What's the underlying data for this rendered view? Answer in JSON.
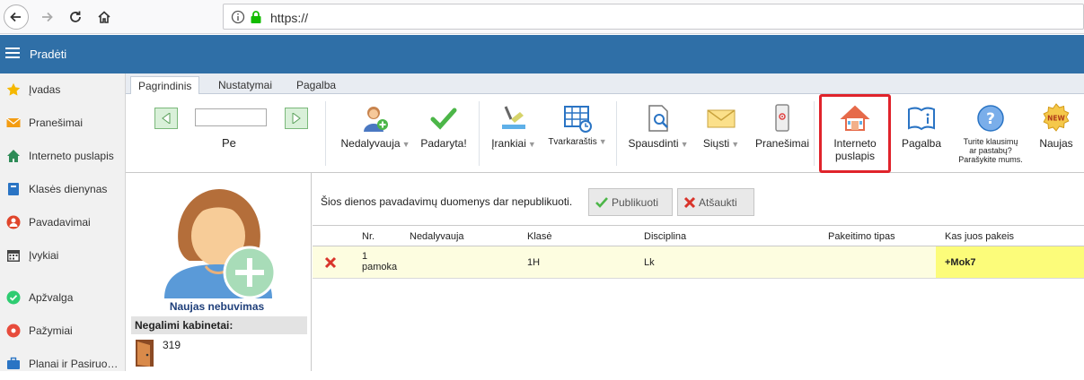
{
  "browser": {
    "url": "https://"
  },
  "header": {
    "title": "Pradėti"
  },
  "sidebar": {
    "items": [
      {
        "label": "Įvadas",
        "icon": "star-icon"
      },
      {
        "label": "Pranešimai",
        "icon": "envelope-icon"
      },
      {
        "label": "Interneto puslapis",
        "icon": "home-icon"
      },
      {
        "label": "Klasės dienynas",
        "icon": "book-icon"
      },
      {
        "label": "Pavadavimai",
        "icon": "person-icon"
      },
      {
        "label": "Įvykiai",
        "icon": "calendar-icon"
      },
      {
        "label": "Apžvalga",
        "icon": "check-circle-icon"
      },
      {
        "label": "Pažymiai",
        "icon": "grades-icon"
      },
      {
        "label": "Planai ir Pasiruošimas",
        "icon": "briefcase-icon"
      }
    ]
  },
  "ribbon": {
    "tabs": [
      "Pagrindinis",
      "Nustatymai",
      "Pagalba"
    ],
    "active_tab": "Pagrindinis",
    "date_label": "Pe",
    "date_value": "",
    "buttons": {
      "nedalyvauja": "Nedalyvauja",
      "padaryta": "Padaryta!",
      "irankiai": "Įrankiai",
      "tvarkarastis": "Tvarkaraštis",
      "spausdinti": "Spausdinti",
      "siusti": "Siųsti",
      "pranesimai": "Pranešimai",
      "interneto_1": "Interneto",
      "interneto_2": "puslapis",
      "pagalba": "Pagalba",
      "klausimai_1": "Turite klausimų",
      "klausimai_2": "ar pastabų?",
      "klausimai_3": "Parašykite mums.",
      "naujas": "Naujas",
      "new_badge": "NEW"
    }
  },
  "info_panel": {
    "new_absence": "Naujas nebuvimas",
    "rooms_title": "Negalimi kabinetai:",
    "rooms": [
      "319"
    ]
  },
  "main": {
    "status": "Šios dienos pavadavimų duomenys dar nepublikuoti.",
    "publish_label": "Publikuoti",
    "cancel_label": "Atšaukti",
    "columns": [
      "Nr.",
      "Nedalyvauja",
      "Klasė",
      "Disciplina",
      "Pakeitimo tipas",
      "Kas juos pakeis"
    ],
    "rows": [
      {
        "nr_1": "1",
        "nr_2": "pamoka",
        "absent": "",
        "class": "1H",
        "discipline": "Lk",
        "change_type": "",
        "replacement": "+Mok7"
      }
    ]
  },
  "colors": {
    "header_bg": "#2f6fa7",
    "highlight": "#e0232b",
    "row_bg": "#fdfde0",
    "replacement_bg": "#fcfc7a"
  }
}
